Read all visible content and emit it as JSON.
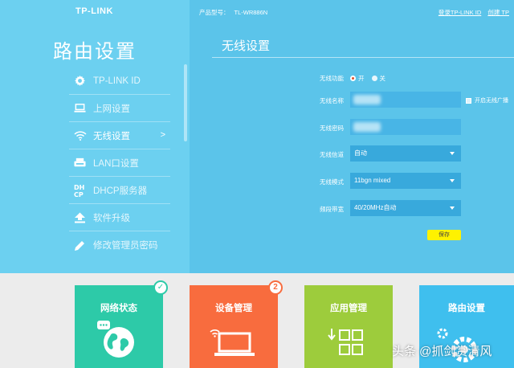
{
  "brand": {
    "logo": "TP-LINK"
  },
  "sidebar": {
    "title": "路由设置",
    "items": [
      {
        "label": "TP-LINK ID",
        "icon": "gear-icon"
      },
      {
        "label": "上网设置",
        "icon": "laptop-icon"
      },
      {
        "label": "无线设置",
        "icon": "wifi-icon",
        "active": true,
        "arrow": ">"
      },
      {
        "label": "LAN口设置",
        "icon": "lan-icon"
      },
      {
        "label": "DHCP服务器",
        "icon": "dhcp-icon"
      },
      {
        "label": "软件升级",
        "icon": "upload-icon"
      },
      {
        "label": "修改管理员密码",
        "icon": "pencil-icon"
      }
    ]
  },
  "header": {
    "model_label": "产品型号：",
    "model_value": "TL-WR886N",
    "login_link": "登录TP-LINK ID",
    "extra_link": "创建 TP"
  },
  "wireless": {
    "title": "无线设置",
    "function_label": "无线功能",
    "on_label": "开",
    "off_label": "关",
    "ssid_label": "无线名称",
    "hide_ssid_label": "开启无线广播",
    "password_label": "无线密码",
    "channel_label": "无线信道",
    "channel_value": "自动",
    "mode_label": "无线模式",
    "mode_value": "11bgn mixed",
    "bandwidth_label": "频段带宽",
    "bandwidth_value": "40/20MHz自动",
    "save_label": "保存"
  },
  "tiles": [
    {
      "title": "网络状态",
      "badge": "✓",
      "color": "#2dcaa8"
    },
    {
      "title": "设备管理",
      "badge": "2",
      "color": "#f86c3e"
    },
    {
      "title": "应用管理",
      "color": "#9dcc3c"
    },
    {
      "title": "路由设置",
      "color": "#3fbfee"
    }
  ],
  "watermark": "头条 @抓剑赏清风"
}
